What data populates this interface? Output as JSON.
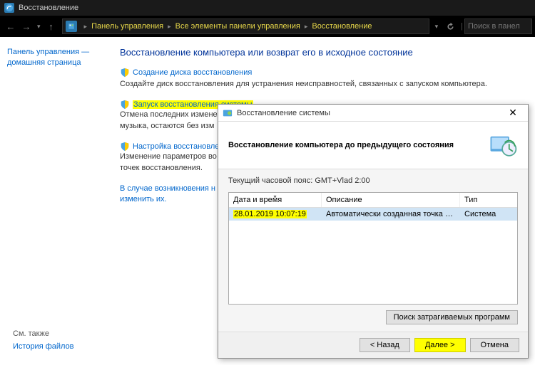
{
  "window": {
    "title": "Восстановление"
  },
  "nav": {
    "breadcrumb": [
      "Панель управления",
      "Все элементы панели управления",
      "Восстановление"
    ],
    "search_placeholder": "Поиск в панел"
  },
  "sidebar": {
    "home_line1": "Панель управления —",
    "home_line2": "домашняя страница",
    "see_also": "См. также",
    "file_history": "История файлов"
  },
  "main": {
    "heading": "Восстановление компьютера или возврат его в исходное состояние",
    "s1": {
      "link": "Создание диска восстановления",
      "desc": "Создайте диск восстановления для устранения неисправностей, связанных с запуском компьютера."
    },
    "s2": {
      "link": "Запуск восстановления системы",
      "desc_l1": "Отмена последних изменен",
      "desc_l2": "музыка, остаются без изм"
    },
    "s3": {
      "link": "Настройка восстановлени",
      "desc_l1": "Изменение параметров во",
      "desc_l2": "точек восстановления."
    },
    "s4": {
      "l1": "В случае возникновения н",
      "l2": "изменить их."
    }
  },
  "dialog": {
    "title": "Восстановление системы",
    "heading": "Восстановление компьютера до предыдущего состояния",
    "tz": "Текущий часовой пояс: GMT+Vlad 2:00",
    "cols": {
      "date": "Дата и время",
      "desc": "Описание",
      "type": "Тип"
    },
    "row": {
      "date": "28.01.2019 10:07:19",
      "desc": "Автоматически созданная точка восстановле...",
      "type": "Система"
    },
    "scan_btn": "Поиск затрагиваемых программ",
    "btn_back": "< Назад",
    "btn_next": "Далее >",
    "btn_cancel": "Отмена"
  }
}
